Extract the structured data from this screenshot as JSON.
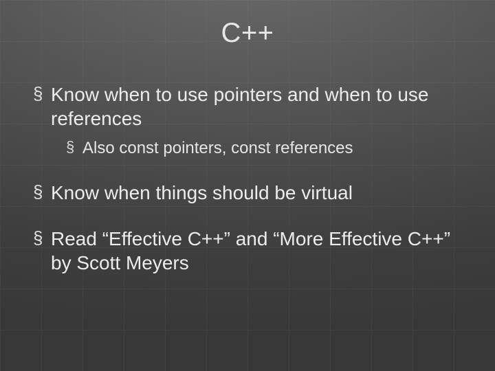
{
  "slide": {
    "title": "C++",
    "bullets": [
      {
        "text": "Know when to use pointers and when to use references",
        "children": [
          {
            "text": "Also const pointers, const references"
          }
        ]
      },
      {
        "text": "Know when things should be virtual",
        "children": []
      },
      {
        "text": "Read “Effective C++” and “More Effective C++” by Scott Meyers",
        "children": []
      }
    ]
  }
}
